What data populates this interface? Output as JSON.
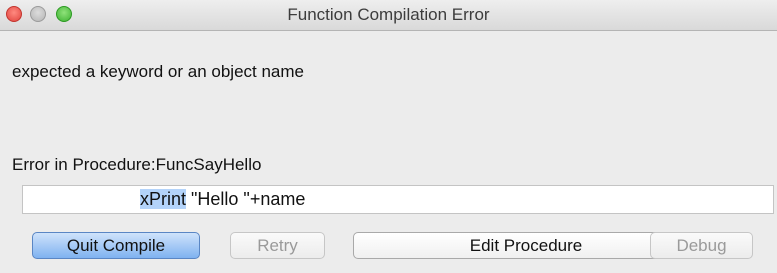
{
  "window": {
    "title": "Function Compilation Error"
  },
  "message": "expected a keyword or an object name",
  "error_location": "Error in Procedure:FuncSayHello",
  "code_line": {
    "highlighted": "xPrint",
    "rest": " \"Hello \"+name"
  },
  "buttons": {
    "quit": "Quit Compile",
    "retry": "Retry",
    "edit": "Edit Procedure",
    "debug": "Debug"
  },
  "colors": {
    "highlight": "#b3d3fa",
    "default_button": "#7fb2f0"
  }
}
